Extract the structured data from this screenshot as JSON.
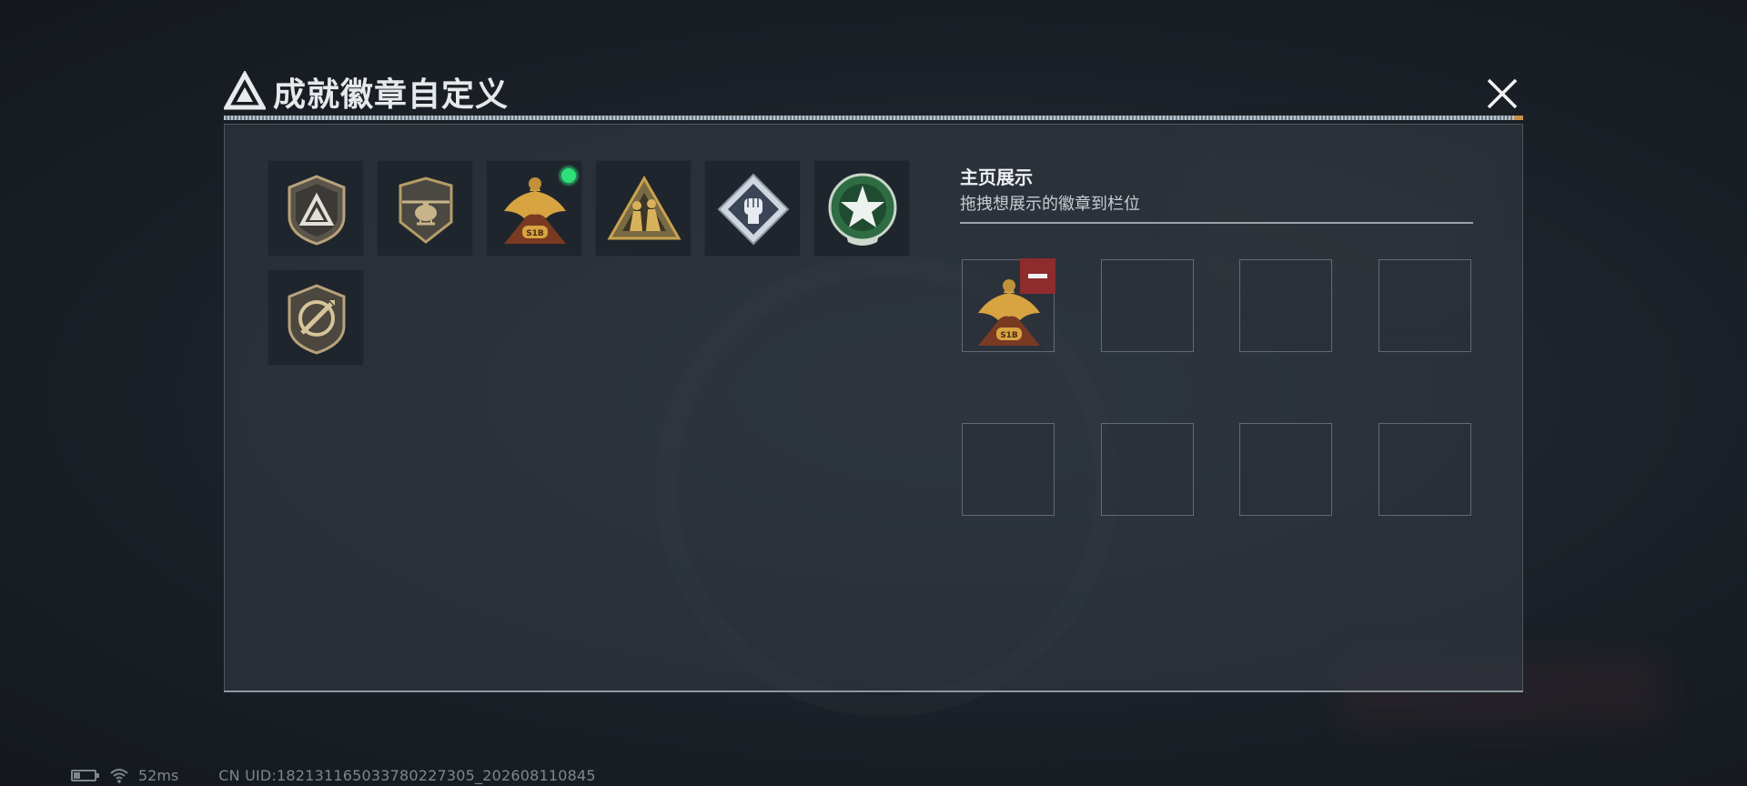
{
  "header": {
    "title": "成就徽章自定义"
  },
  "badges": [
    {
      "name": "delta-shield-badge",
      "has_new_dot": false
    },
    {
      "name": "helicopter-badge",
      "has_new_dot": false
    },
    {
      "name": "golden-eagle-s1b-badge",
      "has_new_dot": true
    },
    {
      "name": "soldiers-triangle-badge",
      "has_new_dot": false
    },
    {
      "name": "fist-diamond-badge",
      "has_new_dot": false
    },
    {
      "name": "green-star-wreath-badge",
      "has_new_dot": false
    },
    {
      "name": "knife-shield-badge",
      "has_new_dot": false
    }
  ],
  "showcase": {
    "title": "主页展示",
    "subtitle": "拖拽想展示的徽章到栏位",
    "slots": [
      "golden-eagle-s1b-badge",
      "",
      "",
      "",
      "",
      "",
      "",
      ""
    ]
  },
  "eagle_label": "S1B",
  "status": {
    "ping": "52ms",
    "uid": "CN UID:182131165033780227305_202608110845"
  },
  "colors": {
    "accent_gold": "#c9a24e",
    "new_dot": "#2ee07a",
    "remove_red": "#8e2b2c"
  }
}
